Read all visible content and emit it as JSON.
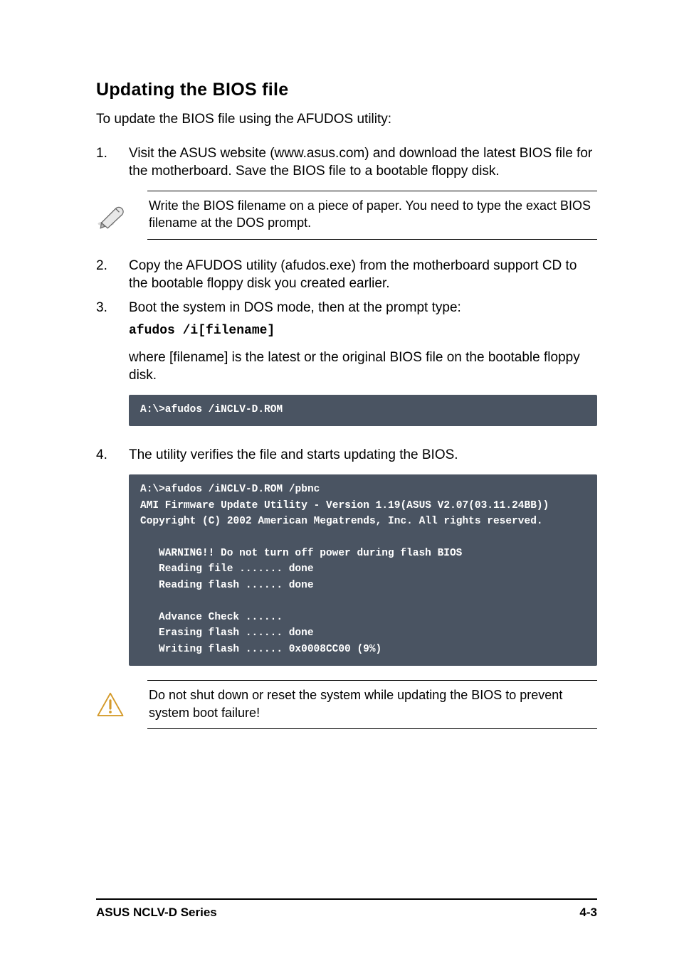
{
  "heading": "Updating the BIOS file",
  "intro": "To update the BIOS file using the AFUDOS utility:",
  "steps": {
    "s1": {
      "num": "1.",
      "text": "Visit the ASUS website (www.asus.com) and download the latest BIOS file for the motherboard. Save the BIOS file to a bootable floppy disk."
    },
    "note1": "Write the BIOS filename on a piece of paper. You need to type the exact BIOS filename at the DOS prompt.",
    "s2": {
      "num": "2.",
      "text": "Copy the AFUDOS utility (afudos.exe) from the motherboard support CD to the bootable floppy disk you created earlier."
    },
    "s3": {
      "num": "3.",
      "text": "Boot the system in DOS mode, then at the prompt type:"
    },
    "code_afudos": "afudos /i[filename]",
    "s3b": "where [filename] is the latest or the original BIOS file on the bootable floppy disk.",
    "term1": "A:\\>afudos /iNCLV-D.ROM",
    "s4": {
      "num": "4.",
      "text": "The utility verifies the file and starts updating the BIOS."
    },
    "term2_l1": "A:\\>afudos /iNCLV-D.ROM /pbnc",
    "term2_l2": "AMI Firmware Update Utility - Version 1.19(ASUS V2.07(03.11.24BB))",
    "term2_l3": "Copyright (C) 2002 American Megatrends, Inc. All rights reserved.",
    "term2_l4": "WARNING!! Do not turn off power during flash BIOS",
    "term2_l5": "Reading file ....... done",
    "term2_l6": "Reading flash ...... done",
    "term2_l7": "Advance Check ......",
    "term2_l8": "Erasing flash ...... done",
    "term2_l9": "Writing flash ...... 0x0008CC00 (9%)",
    "warn": "Do not shut down or reset the system while updating the BIOS to prevent system boot failure!"
  },
  "footer": {
    "left": "ASUS NCLV-D Series",
    "right": "4-3"
  }
}
